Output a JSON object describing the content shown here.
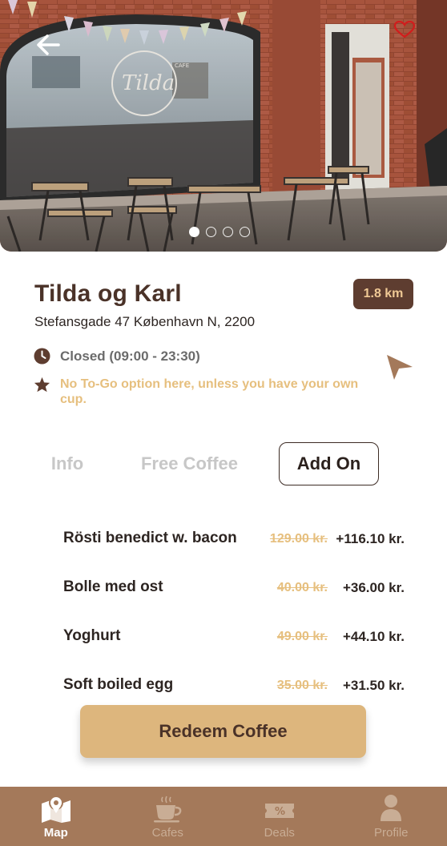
{
  "colors": {
    "brand_dark": "#5e3d30",
    "accent_gold": "#ddb67d",
    "note_gold": "#e6bf7e",
    "tabbar_bg": "#a4795a"
  },
  "hero": {
    "image_slides": 4,
    "active_slide": 1,
    "window_sign": "Tilda",
    "window_sign_small": "CAFE",
    "back_icon": "arrow-left-icon",
    "favorite_icon": "heart-icon"
  },
  "cafe": {
    "name": "Tilda og Karl",
    "distance": "1.8 km",
    "address": "Stefansgade 47 København N, 2200",
    "hours": "Closed (09:00 - 23:30)",
    "note": "No To-Go option here, unless you have your own cup."
  },
  "tabs": [
    {
      "label": "Info",
      "active": false
    },
    {
      "label": "Free Coffee",
      "active": false
    },
    {
      "label": "Add On",
      "active": true
    }
  ],
  "addons": [
    {
      "name": "Rösti benedict w. bacon",
      "old_price": "129.00 kr.",
      "new_price": "+116.10 kr."
    },
    {
      "name": "Bolle med ost",
      "old_price": "40.00 kr.",
      "new_price": "+36.00 kr."
    },
    {
      "name": "Yoghurt",
      "old_price": "49.00 kr.",
      "new_price": "+44.10 kr."
    },
    {
      "name": "Soft boiled egg",
      "old_price": "35.00 kr.",
      "new_price": "+31.50 kr."
    }
  ],
  "redeem_label": "Redeem Coffee",
  "tabbar": [
    {
      "label": "Map",
      "icon": "map-pin-icon",
      "active": true
    },
    {
      "label": "Cafes",
      "icon": "coffee-cup-icon",
      "active": false
    },
    {
      "label": "Deals",
      "icon": "discount-ticket-icon",
      "active": false
    },
    {
      "label": "Profile",
      "icon": "user-icon",
      "active": false
    }
  ]
}
